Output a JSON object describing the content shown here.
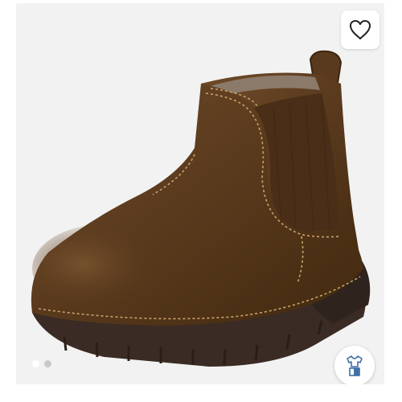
{
  "product": {
    "image_alt": "",
    "image_description_icon": "brown-chelsea-boot",
    "colors": {
      "background": "#f2f2f2",
      "leather": "#5b3b1e",
      "elastic": "#4a2e18",
      "sole": "#3a2b24",
      "stitching": "#c9a26b"
    }
  },
  "wishlist": {
    "icon": "heart-icon"
  },
  "carousel": {
    "total": 2,
    "active": 1
  },
  "try_on": {
    "icon": "outfit-icon",
    "accent": "#3f6fa8"
  }
}
